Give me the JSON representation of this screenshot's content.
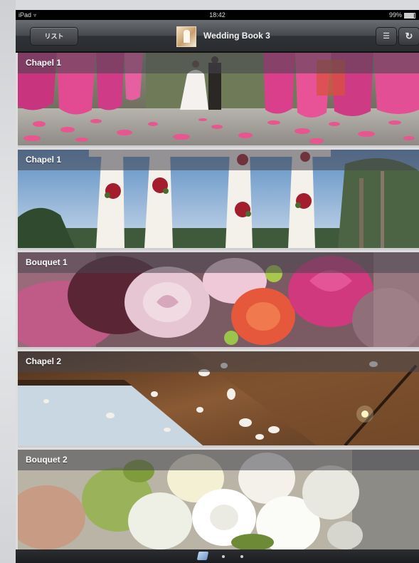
{
  "status_bar": {
    "device": "iPad",
    "time": "18:42",
    "battery": "99%"
  },
  "nav": {
    "back_label": "リスト",
    "title": "Wedding Book 3"
  },
  "panels": [
    {
      "label": "Chapel 1"
    },
    {
      "label": "Chapel 1"
    },
    {
      "label": "Bouquet 1"
    },
    {
      "label": "Chapel 2"
    },
    {
      "label": "Bouquet 2"
    }
  ],
  "pager": {
    "page_count": 3,
    "current_page": 1
  },
  "colors": {
    "nav_bar": "#3a3d42",
    "petal_pink": "#e0488d",
    "label_overlay": "#46464e"
  },
  "icons": [
    "wifi-icon",
    "battery-icon",
    "book-cover-thumbnail",
    "list-icon",
    "refresh-icon",
    "page-cube-icon"
  ]
}
